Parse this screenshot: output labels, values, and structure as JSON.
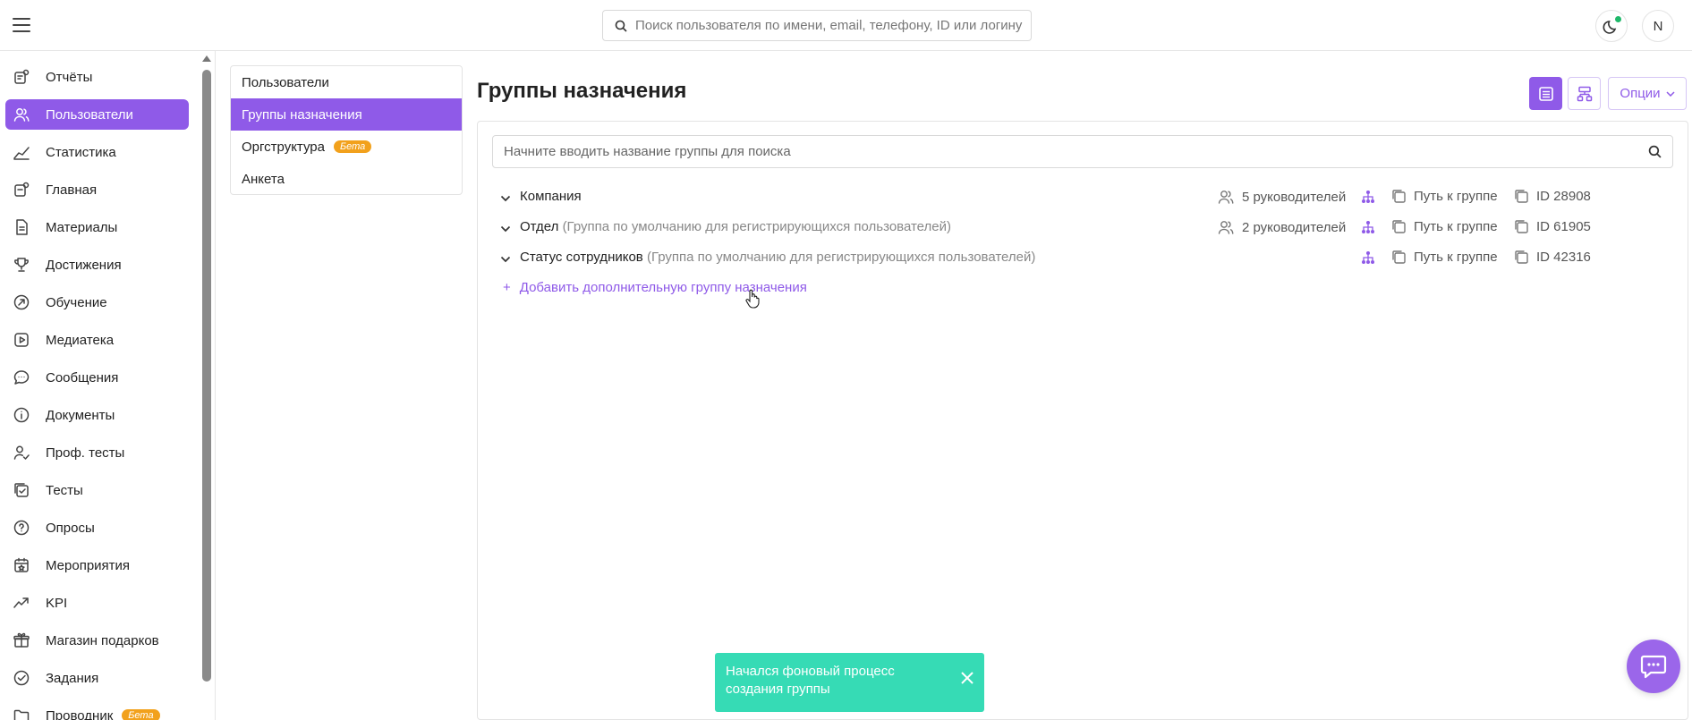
{
  "header": {
    "search_placeholder": "Поиск пользователя по имени, email, телефону, ID или логину",
    "avatar_initial": "N"
  },
  "sidebar": {
    "items": [
      {
        "label": "Отчёты",
        "icon": "report-icon"
      },
      {
        "label": "Пользователи",
        "icon": "users-icon",
        "active": true
      },
      {
        "label": "Статистика",
        "icon": "chart-line-icon"
      },
      {
        "label": "Главная",
        "icon": "home-icon"
      },
      {
        "label": "Материалы",
        "icon": "document-icon"
      },
      {
        "label": "Достижения",
        "icon": "trophy-icon"
      },
      {
        "label": "Обучение",
        "icon": "learning-icon"
      },
      {
        "label": "Медиатека",
        "icon": "play-icon"
      },
      {
        "label": "Сообщения",
        "icon": "chat-icon"
      },
      {
        "label": "Документы",
        "icon": "info-icon"
      },
      {
        "label": "Проф. тесты",
        "icon": "user-check-icon"
      },
      {
        "label": "Тесты",
        "icon": "test-icon"
      },
      {
        "label": "Опросы",
        "icon": "question-icon"
      },
      {
        "label": "Мероприятия",
        "icon": "calendar-icon"
      },
      {
        "label": "KPI",
        "icon": "trend-icon"
      },
      {
        "label": "Магазин подарков",
        "icon": "gift-icon"
      },
      {
        "label": "Задания",
        "icon": "check-circle-icon"
      },
      {
        "label": "Проводник",
        "icon": "folder-icon",
        "badge": "Бета"
      }
    ]
  },
  "subnav": {
    "items": [
      {
        "label": "Пользователи"
      },
      {
        "label": "Группы назначения",
        "active": true
      },
      {
        "label": "Оргструктура",
        "badge": "Бета"
      },
      {
        "label": "Анкета"
      }
    ]
  },
  "main": {
    "title": "Группы назначения",
    "options_label": "Опции",
    "group_search_placeholder": "Начните вводить название группы для поиска",
    "groups": [
      {
        "name": "Компания",
        "note": "",
        "managers": "5 руководителей",
        "path": "Путь к группе",
        "id": "ID 28908"
      },
      {
        "name": "Отдел",
        "note": "(Группа по умолчанию для регистрирующихся пользователей)",
        "managers": "2 руководителей",
        "path": "Путь к группе",
        "id": "ID 61905"
      },
      {
        "name": "Статус сотрудников",
        "note": "(Группа по умолчанию для регистрирующихся пользователей)",
        "managers": "",
        "path": "Путь к группе",
        "id": "ID 42316"
      }
    ],
    "add_group_label": "Добавить дополнительную группу назначения",
    "add_group_plus": "+"
  },
  "toast": {
    "message": "Начался фоновый процесс создания группы"
  },
  "colors": {
    "accent": "#8f5ae8",
    "toast": "#36dbb5",
    "beta": "#f2a11c"
  }
}
